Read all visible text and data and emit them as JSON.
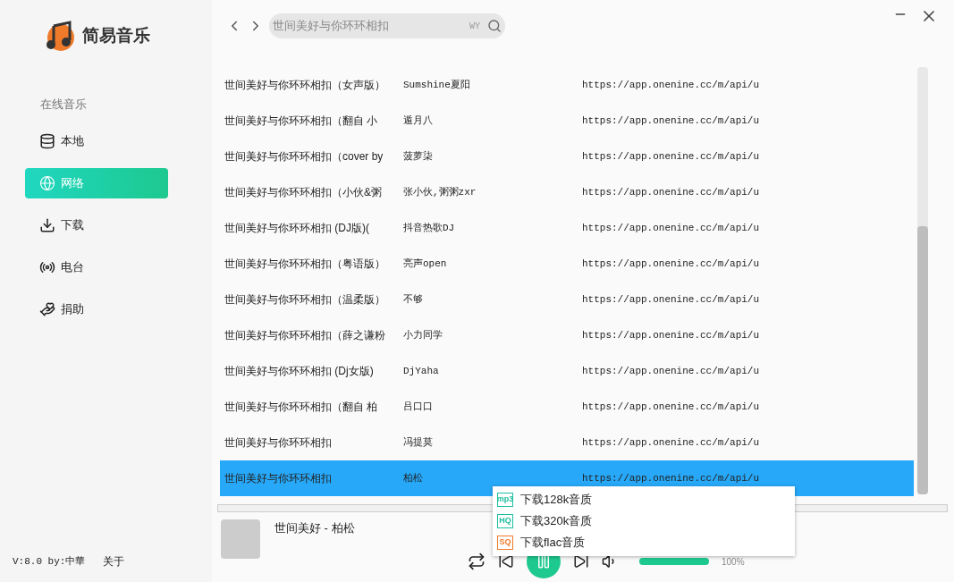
{
  "sidebar": {
    "app_name": "简易音乐",
    "section": "在线音乐",
    "items": [
      {
        "label": "本地",
        "selected": false
      },
      {
        "label": "网络",
        "selected": true
      },
      {
        "label": "下载",
        "selected": false
      },
      {
        "label": "电台",
        "selected": false
      },
      {
        "label": "捐助",
        "selected": false
      }
    ],
    "version": "V:8.0 by:中華",
    "about": "关于"
  },
  "search": {
    "value": "世间美好与你环环相扣",
    "source": "WY"
  },
  "songs": [
    {
      "title": "世间美好与你环环相扣（女声版）",
      "artist": "Sumshine夏阳",
      "url": "https://app.onenine.cc/m/api/u",
      "selected": false
    },
    {
      "title": "世间美好与你环环相扣（翻自 小",
      "artist": "遁月八",
      "url": "https://app.onenine.cc/m/api/u",
      "selected": false
    },
    {
      "title": "世间美好与你环环相扣（cover by",
      "artist": "菠萝柒",
      "url": "https://app.onenine.cc/m/api/u",
      "selected": false
    },
    {
      "title": "世间美好与你环环相扣（小伙&粥",
      "artist": "张小伙,粥粥zxr",
      "url": "https://app.onenine.cc/m/api/u",
      "selected": false
    },
    {
      "title": "世间美好与你环环相扣 (DJ版)(",
      "artist": "抖音热歌DJ",
      "url": "https://app.onenine.cc/m/api/u",
      "selected": false
    },
    {
      "title": "世间美好与你环环相扣（粤语版）",
      "artist": "亮声open",
      "url": "https://app.onenine.cc/m/api/u",
      "selected": false
    },
    {
      "title": "世间美好与你环环相扣（温柔版）",
      "artist": "不够",
      "url": "https://app.onenine.cc/m/api/u",
      "selected": false
    },
    {
      "title": "世间美好与你环环相扣（薛之谦粉",
      "artist": "小力同学",
      "url": "https://app.onenine.cc/m/api/u",
      "selected": false
    },
    {
      "title": "世间美好与你环环相扣 (Dj女版)",
      "artist": "DjYaha",
      "url": "https://app.onenine.cc/m/api/u",
      "selected": false
    },
    {
      "title": "世间美好与你环环相扣（翻自 柏",
      "artist": "吕口口",
      "url": "https://app.onenine.cc/m/api/u",
      "selected": false
    },
    {
      "title": "世间美好与你环环相扣",
      "artist": "冯提莫",
      "url": "https://app.onenine.cc/m/api/u",
      "selected": false
    },
    {
      "title": "世间美好与你环环相扣",
      "artist": "柏松",
      "url": "https://app.onenine.cc/m/api/u",
      "selected": true
    }
  ],
  "player": {
    "now_playing": "世间美好 - 柏松",
    "playing": true,
    "volume": {
      "level": 1.0,
      "reading": "100%"
    }
  },
  "context_menu": [
    {
      "badge": "mp3",
      "label": "下载128k音质",
      "color": "#1fbfa0"
    },
    {
      "badge": "HQ",
      "label": "下载320k音质",
      "color": "#1fbfa0"
    },
    {
      "badge": "SQ",
      "label": "下载flac音质",
      "color": "#f07a2a"
    }
  ]
}
